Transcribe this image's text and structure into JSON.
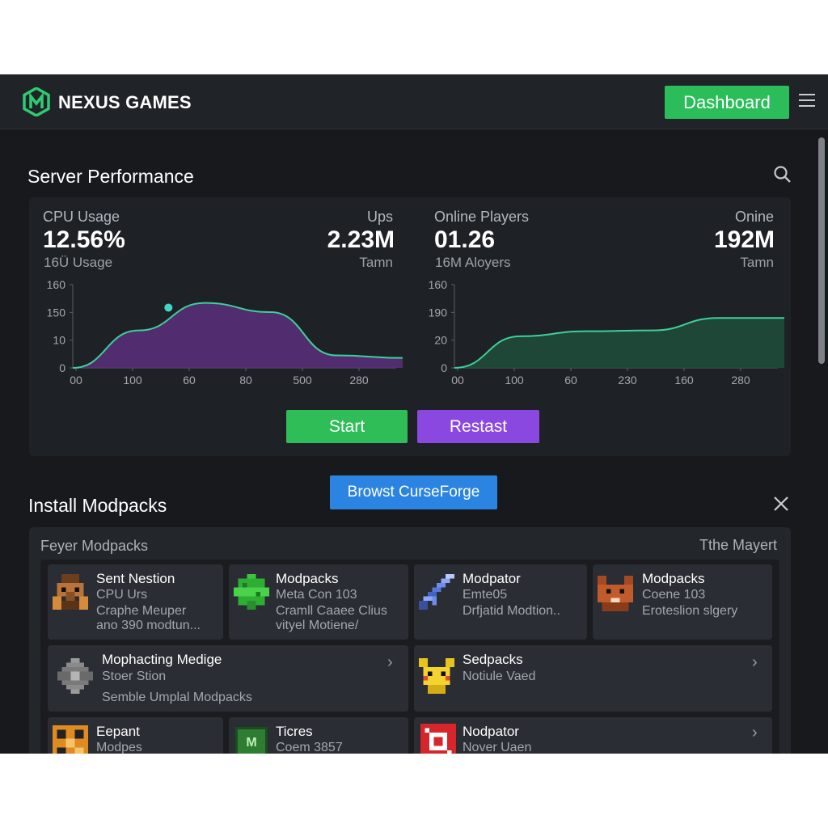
{
  "header": {
    "brand": "NEXUS GAMES",
    "dashboard_label": "Dashboard"
  },
  "performance": {
    "title": "Server Performance",
    "cpu": {
      "label": "CPU Usage",
      "value": "12.56%",
      "sub": "16Ü Usage"
    },
    "ups": {
      "label": "Ups",
      "value": "2.23M",
      "sub": "Tamn"
    },
    "players": {
      "label": "Online Players",
      "value": "01.26",
      "sub": "16M Aloyers"
    },
    "online": {
      "label": "Onine",
      "value": "192M",
      "sub": "Tamn"
    },
    "start_label": "Start",
    "restart_label": "Restast"
  },
  "chart_data": [
    {
      "type": "area",
      "x_tick_labels": [
        "00",
        "100",
        "60",
        "80",
        "500",
        "280"
      ],
      "y_tick_labels": [
        "0",
        "10",
        "150",
        "160"
      ],
      "series": [
        {
          "color": "#3fcf9a",
          "fill": "#5a2f7e",
          "values": [
            0.0,
            0.45,
            0.78,
            0.67,
            0.15,
            0.12
          ]
        }
      ],
      "marker_point": 1.45
    },
    {
      "type": "area",
      "x_tick_labels": [
        "00",
        "100",
        "60",
        "230",
        "160",
        "280"
      ],
      "y_tick_labels": [
        "0",
        "20",
        "190",
        "160"
      ],
      "series": [
        {
          "color": "#3fcf9a",
          "fill": "#1f4d3c",
          "values": [
            0.0,
            0.38,
            0.44,
            0.45,
            0.6,
            0.6
          ]
        }
      ]
    }
  ],
  "modpacks": {
    "title": "Install Modpacks",
    "browse_label": "Browst CurseForge",
    "header_left": "Feyer Modpacks",
    "header_right": "Tthe Mayert",
    "cards": [
      {
        "title": "Sent Nestion",
        "lines": [
          "CPU Urs",
          "Craphe Meuper",
          "ano 390 modtun..."
        ],
        "icon": "pixel-villager-icon"
      },
      {
        "title": "Modpacks",
        "lines": [
          "Meta Con 103",
          "Cramll Caaee Clius",
          "vityel Motiene/"
        ],
        "icon": "pixel-creeper-icon"
      },
      {
        "title": "Modpator",
        "lines": [
          "Emte05",
          "Drfjatid Modtion.."
        ],
        "icon": "pixel-sword-icon"
      },
      {
        "title": "Modpacks",
        "lines": [
          "Coene 103",
          "Eroteslion slgery"
        ],
        "icon": "pixel-fox-icon"
      },
      {
        "title": "Mophacting Medige",
        "lines": [
          "Stoer Stion",
          "Semble Umplal Modpacks"
        ],
        "icon": "pixel-stone-icon"
      },
      {
        "title": "Sedpacks",
        "lines": [
          "Notiule Vaed"
        ],
        "icon": "pixel-pikachu-icon"
      },
      {
        "title": "Eepant",
        "lines": [
          "Modpes"
        ],
        "icon": "pixel-orange-icon"
      },
      {
        "title": "Ticres",
        "lines": [
          "Coem 3857"
        ],
        "icon": "pixel-m-icon",
        "badge": "M"
      },
      {
        "title": "Nodpator",
        "lines": [
          "Nover Uaen"
        ],
        "icon": "pixel-red-icon"
      }
    ]
  }
}
